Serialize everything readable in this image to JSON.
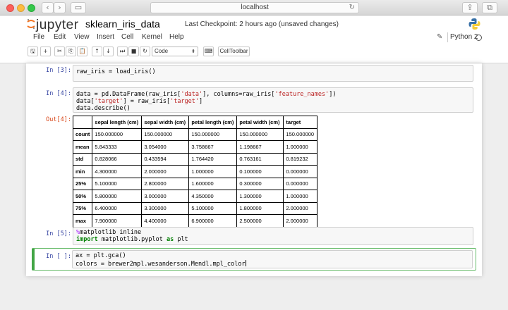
{
  "browser": {
    "address": "localhost",
    "reload_glyph": "↻",
    "back_glyph": "‹",
    "forward_glyph": "›",
    "sidebar_glyph": "▭",
    "share_glyph": "⇪",
    "tabs_glyph": "⧉",
    "newtab_glyph": "+"
  },
  "jupyter": {
    "logo_text": "jupyter",
    "notebook_name": "sklearn_iris_data",
    "checkpoint": "Last Checkpoint: 2 hours ago (unsaved changes)",
    "menu": [
      "File",
      "Edit",
      "View",
      "Insert",
      "Cell",
      "Kernel",
      "Help"
    ],
    "kernel_name": "Python 2",
    "pencil_glyph": "✎",
    "toolbar": {
      "save": "🖫",
      "add": "+",
      "cut": "✂",
      "copy": "⎘",
      "paste": "📋",
      "move_up": "↑",
      "move_down": "↓",
      "step": "⏭",
      "stop": "■",
      "restart": "↻",
      "cell_type": "Code",
      "cell_type_arrow": "⬍",
      "keyboard": "⌨",
      "celltoolbar": "CellToolbar"
    }
  },
  "cells": [
    {
      "prompt": "In [3]:"
    },
    {
      "prompt": "In [4]:",
      "out_prompt": "Out[4]:"
    },
    {
      "prompt": "In [5]:"
    },
    {
      "prompt": "In [ ]:"
    }
  ],
  "describe_table": {
    "columns": [
      "",
      "sepal length (cm)",
      "sepal width (cm)",
      "petal length (cm)",
      "petal width (cm)",
      "target"
    ],
    "rows": [
      [
        "count",
        "150.000000",
        "150.000000",
        "150.000000",
        "150.000000",
        "150.000000"
      ],
      [
        "mean",
        "5.843333",
        "3.054000",
        "3.758667",
        "1.198667",
        "1.000000"
      ],
      [
        "std",
        "0.828066",
        "0.433594",
        "1.764420",
        "0.763161",
        "0.819232"
      ],
      [
        "min",
        "4.300000",
        "2.000000",
        "1.000000",
        "0.100000",
        "0.000000"
      ],
      [
        "25%",
        "5.100000",
        "2.800000",
        "1.600000",
        "0.300000",
        "0.000000"
      ],
      [
        "50%",
        "5.800000",
        "3.000000",
        "4.350000",
        "1.300000",
        "1.000000"
      ],
      [
        "75%",
        "6.400000",
        "3.300000",
        "5.100000",
        "1.800000",
        "2.000000"
      ],
      [
        "max",
        "7.900000",
        "4.400000",
        "6.900000",
        "2.500000",
        "2.000000"
      ]
    ]
  },
  "code": {
    "c3_line1": "raw_iris = load_iris()",
    "c4_a": "data = pd.DataFrame(raw_iris[",
    "c4_b": "'data'",
    "c4_c": "], columns=raw_iris[",
    "c4_d": "'feature_names'",
    "c4_e": "])",
    "c4_f": "data[",
    "c4_g": "'target'",
    "c4_h": "] = raw_iris[",
    "c4_i": "'target'",
    "c4_j": "]",
    "c4_k": "data.describe()",
    "c5_magic": "%",
    "c5_a": "matplotlib inline",
    "c5_import": "import",
    "c5_b": " matplotlib.pyplot ",
    "c5_as": "as",
    "c5_c": " plt",
    "c6_line1": "ax = plt.gca()",
    "c6_line2": "colors = brewer2mpl.wesanderson.Mendl.mpl_color"
  },
  "colors": {
    "jupyter_orange": "#f37726",
    "prompt_in": "#303f9f",
    "prompt_out": "#d84315",
    "selected_border": "#42a545"
  }
}
